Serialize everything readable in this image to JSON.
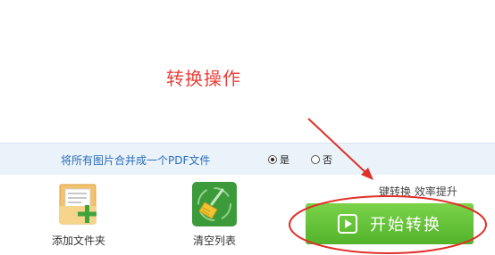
{
  "annotation": {
    "title": "转换操作"
  },
  "merge_option": {
    "label": "将所有图片合并成一个PDF文件",
    "yes_label": "是",
    "no_label": "否",
    "selected": "是"
  },
  "toolbar": {
    "add_folder_label": "添加文件夹",
    "clear_list_label": "清空列表"
  },
  "tagline": "键转换 效率提升",
  "start_button": {
    "label": "开始转换"
  },
  "colors": {
    "annotation_red": "#e8413a",
    "button_green": "#5cbf2f",
    "link_blue": "#2b6cb8"
  }
}
